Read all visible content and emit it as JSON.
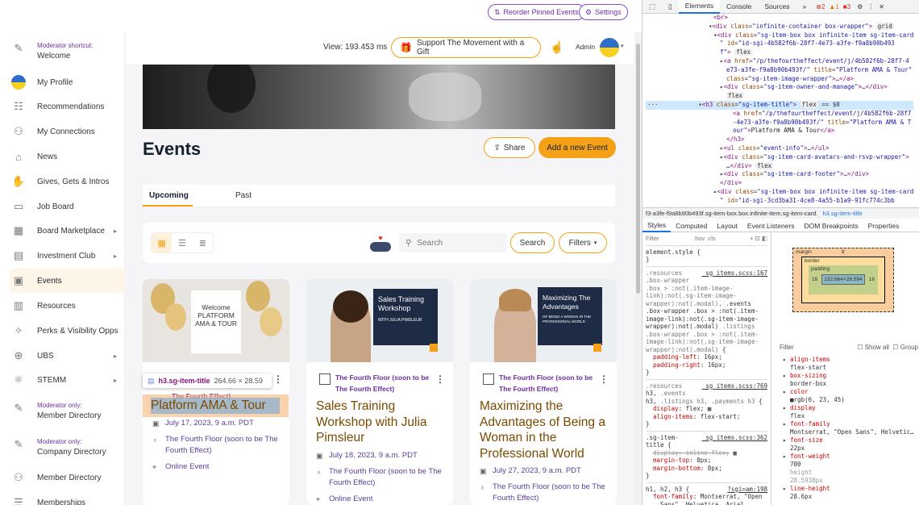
{
  "top": {
    "reorder": "Reorder Pinned Events",
    "settings": "Settings"
  },
  "header": {
    "view": "View: 193.453 ms",
    "support": "Support The Movement with a Gift",
    "admin": "Admin"
  },
  "sidebar": {
    "mod1_label": "Moderator shortcut:",
    "mod1": "Welcome",
    "items": [
      "My Profile",
      "Recommendations",
      "My Connections",
      "News",
      "Gives, Gets & Intros",
      "Job Board",
      "Board Marketplace",
      "Investment Club",
      "Events",
      "Resources",
      "Perks & Visibility Opps",
      "UBS",
      "STEMM"
    ],
    "mod2_label": "Moderator only:",
    "mod2": "Member Directory",
    "mod3_label": "Moderator only:",
    "mod3": "Company Directory",
    "member_dir": "Member Directory",
    "memberships": "Memberships"
  },
  "page": {
    "title": "Events",
    "share": "Share",
    "add": "Add a new Event",
    "tab_upcoming": "Upcoming",
    "tab_past": "Past",
    "search_placeholder": "Search",
    "search_btn": "Search",
    "filters": "Filters"
  },
  "cards": [
    {
      "owner": "The Fourth Floor (soon to be The Fourth Effect)",
      "title": "Platform AMA & Tour",
      "date": "July 17, 2023, 9 a.m. PDT",
      "loc": "The Fourth Floor (soon to be The Fourth Effect)",
      "online": "Online Event",
      "img_text": "Welcome PLATFORM AMA & TOUR"
    },
    {
      "owner": "The Fourth Floor (soon to be The Fourth Effect)",
      "title": "Sales Training Workshop with Julia Pimsleur",
      "date": "July 18, 2023, 9 a.m. PDT",
      "loc": "The Fourth Floor (soon to be The Fourth Effect)",
      "online": "Online Event",
      "img_text": "Sales Training Workshop",
      "img_sub": "WITH JULIA PIMSLEUR"
    },
    {
      "owner": "The Fourth Floor (soon to be The Fourth Effect)",
      "title": "Maximizing the Advantages of Being a Woman in the Professional World",
      "date": "July 27, 2023, 9 a.m. PDT",
      "loc": "The Fourth Floor (soon to be The Fourth Effect)",
      "img_text": "Maximizing The Advantages",
      "img_sub": "OF BEING A WOMAN IN THE PROFESSIONAL WORLD"
    }
  ],
  "tooltip": {
    "selector": "h3.sg-item-title",
    "size": "264.66 × 28.59"
  },
  "devtools": {
    "tabs": [
      "Elements",
      "Console",
      "Sources"
    ],
    "errors": "2",
    "warnings": "1",
    "info": "3",
    "crumb1": "f3-a3fe-f9a8b90b493f.sg-item-box.box.infinite-item.sg-item-card.",
    "crumb2": "h3.sg-item-title",
    "stabs": [
      "Styles",
      "Computed",
      "Layout",
      "Event Listeners",
      "DOM Breakpoints",
      "Properties"
    ],
    "filter": "Filter",
    "hov": ":hov .cls",
    "showall": "Show all",
    "group": "Group",
    "bm": {
      "margin": "margin",
      "border": "border",
      "padding": "padding",
      "content": "232.664×28.594",
      "m": "8",
      "b": "–",
      "p": "16"
    }
  }
}
